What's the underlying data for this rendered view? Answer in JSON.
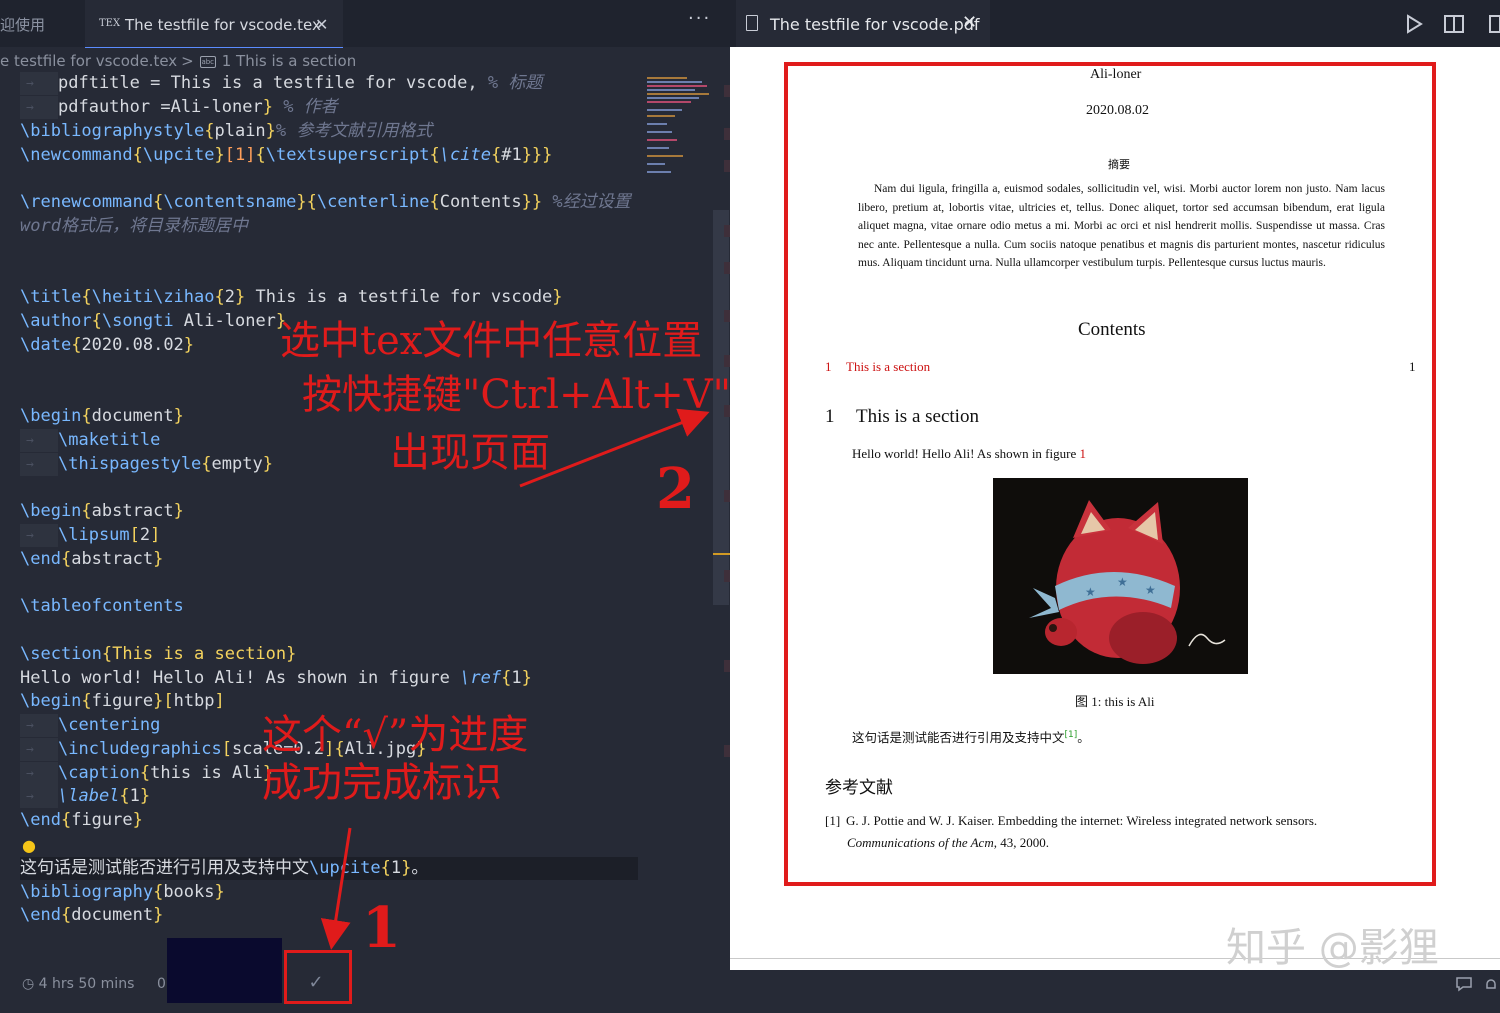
{
  "editor": {
    "inactive_tab_label": "迎使用",
    "active_tab_icon": "TEX",
    "active_tab_label": "The testfile for vscode.tex",
    "more_actions": "···",
    "breadcrumb": {
      "file": "e testfile for vscode.tex",
      "sep": ">",
      "section_icon": "abc",
      "section": "1 This is a section"
    },
    "status": {
      "time": "4 hrs 50 mins",
      "extra": "0",
      "check": "✓"
    },
    "code_lines": {
      "l1_a": "pdftitle = This is a testfile for vscode,",
      "l1_b": "% 标题",
      "l2_a": "pdfauthor =Ali-loner",
      "l2_b": "}",
      "l2_c": " % 作者",
      "l3_cmd": "\\bibliographystyle",
      "l3_arg": "plain",
      "l3_c": "% 参考文献引用格式",
      "l4": "\\newcommand",
      "l4_a": "\\upcite",
      "l4_b": "1",
      "l4_c": "\\textsuperscript",
      "l4_d": "\\cite",
      "l4_e": "#1",
      "l5_cmd": "\\renewcommand",
      "l5_a": "\\contentsname",
      "l5_b": "\\centerline",
      "l5_c": "Contents",
      "l5_comment": "%经过设置",
      "l6_comment": "word格式后，将目录标题居中",
      "l7_cmd": "\\title",
      "l7_a": "\\heiti\\zihao",
      "l7_b": "2",
      "l7_c": " This is a testfile for vscode",
      "l8_cmd": "\\author",
      "l8_a": "\\songti",
      "l8_b": " Ali-loner",
      "l9_cmd": "\\date",
      "l9_a": "2020.08.02",
      "l10_cmd": "\\begin",
      "l10_a": "document",
      "l11": "\\maketitle",
      "l12_cmd": "\\thispagestyle",
      "l12_a": "empty",
      "l13_cmd": "\\begin",
      "l13_a": "abstract",
      "l14_cmd": "\\lipsum",
      "l14_a": "2",
      "l15_cmd": "\\end",
      "l15_a": "abstract",
      "l16": "\\tableofcontents",
      "l17_cmd": "\\section",
      "l17_a": "This is a section",
      "l18_a": "Hello world! Hello Ali! As shown in figure ",
      "l18_cmd": "\\ref",
      "l18_b": "1",
      "l19_cmd": "\\begin",
      "l19_a": "figure",
      "l19_b": "htbp",
      "l20": "\\centering",
      "l21_cmd": "\\includegraphics",
      "l21_a": "scale=0.2",
      "l21_b": "Ali.jpg",
      "l22_cmd": "\\caption",
      "l22_a": "this is Ali",
      "l23_cmd": "\\label",
      "l23_a": "1",
      "l24_cmd": "\\end",
      "l24_a": "figure",
      "l25_a": "这句话是测试能否进行引用及支持中文",
      "l25_cmd": "\\upcite",
      "l25_b": "1",
      "l25_c": "。",
      "l26_cmd": "\\bibliography",
      "l26_a": "books",
      "l27_cmd": "\\end",
      "l27_a": "document"
    }
  },
  "annotations": {
    "line1": "选中tex文件中任意位置",
    "line2": "按快捷键\"Ctrl+Alt+V\"",
    "line3": "出现页面",
    "line4": "这个“√”为进度",
    "line5": "成功完成标识",
    "num1": "1",
    "num2": "2",
    "color": "#e01b1b"
  },
  "pdf_viewer": {
    "tab_label": "The testfile for vscode.pdf",
    "close": "✕"
  },
  "pdf": {
    "author": "Ali-loner",
    "date": "2020.08.02",
    "abstract_title": "摘要",
    "abstract": "Nam dui ligula, fringilla a, euismod sodales, sollicitudin vel, wisi. Morbi auctor lorem non justo. Nam lacus libero, pretium at, lobortis vitae, ultricies et, tellus. Donec aliquet, tortor sed accumsan bibendum, erat ligula aliquet magna, vitae ornare odio metus a mi. Morbi ac orci et nisl hendrerit mollis. Suspendisse ut massa. Cras nec ante. Pellentesque a nulla. Cum sociis natoque penatibus et magnis dis parturient montes, nascetur ridiculus mus. Aliquam tincidunt urna. Nulla ullamcorper vestibulum turpis. Pellentesque cursus luctus mauris.",
    "contents_title": "Contents",
    "toc": {
      "num": "1",
      "label": "This is a section",
      "page": "1"
    },
    "section": {
      "num": "1",
      "title": "This is a section"
    },
    "hello": "Hello world! Hello Ali! As shown in figure ",
    "hello_ref": "1",
    "caption": "图 1: this is Ali",
    "cite_sentence": "这句话是测试能否进行引用及支持中文",
    "cite_ref": "[1]",
    "cite_end": "。",
    "bib_title": "参考文献",
    "bib_num": "[1]",
    "bib_text": "G. J. Pottie and W. J. Kaiser.  Embedding the internet: Wireless integrated network sensors.",
    "bib_journal": "Communications of the Acm",
    "bib_tail": ", 43, 2000."
  },
  "watermark": "知乎 @影狸"
}
